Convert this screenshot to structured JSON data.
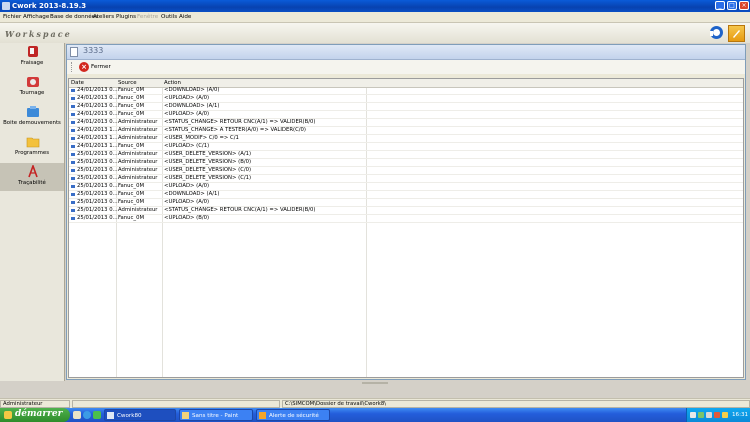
{
  "window": {
    "title": "Cwork 2013-8.19.3"
  },
  "menu": [
    "Fichier",
    "Affichage",
    "Base de données",
    "Ateliers",
    "Plugins",
    "Fenêtre",
    "Outils",
    "Aide"
  ],
  "workspace": {
    "label": "Workspace"
  },
  "sidebar": {
    "items": [
      {
        "label": "Fraisage",
        "icon": "milling-icon"
      },
      {
        "label": "Tournage",
        "icon": "turning-icon"
      },
      {
        "label": "Boite demouvements",
        "icon": "toolbox-icon"
      },
      {
        "label": "Programmes",
        "icon": "folder-icon"
      },
      {
        "label": "Traçabilité",
        "icon": "traceability-icon",
        "selected": true
      }
    ]
  },
  "panel": {
    "title": "3333",
    "close_label": "Fermer"
  },
  "table": {
    "columns": [
      "Date",
      "Source",
      "Action"
    ],
    "rows": [
      [
        "24/01/2013 0...",
        "Fanuc_0M",
        "<DOWNLOAD> (A/0)"
      ],
      [
        "24/01/2013 0...",
        "Fanuc_0M",
        "<UPLOAD> (A/0)"
      ],
      [
        "24/01/2013 0...",
        "Fanuc_0M",
        "<DOWNLOAD> (A/1)"
      ],
      [
        "24/01/2013 0...",
        "Fanuc_0M",
        "<UPLOAD> (A/0)"
      ],
      [
        "24/01/2013 0...",
        "Administrateur",
        "<STATUS_CHANGE> RETOUR CNC(A/1) => VALIDER(B/0)"
      ],
      [
        "24/01/2013 1...",
        "Administrateur",
        "<STATUS_CHANGE> A TESTER(A/0) => VALIDER(C/0)"
      ],
      [
        "24/01/2013 1...",
        "Administrateur",
        "<USER_MODIF> C/0 => C/1"
      ],
      [
        "24/01/2013 1...",
        "Fanuc_0M",
        "<UPLOAD> (C/1)"
      ],
      [
        "25/01/2013 0...",
        "Administrateur",
        "<USER_DELETE_VERSION> (A/1)"
      ],
      [
        "25/01/2013 0...",
        "Administrateur",
        "<USER_DELETE_VERSION> (B/0)"
      ],
      [
        "25/01/2013 0...",
        "Administrateur",
        "<USER_DELETE_VERSION> (C/0)"
      ],
      [
        "25/01/2013 0...",
        "Administrateur",
        "<USER_DELETE_VERSION> (C/1)"
      ],
      [
        "25/01/2013 0...",
        "Fanuc_0M",
        "<UPLOAD> (A/0)"
      ],
      [
        "25/01/2013 0...",
        "Fanuc_0M",
        "<DOWNLOAD> (A/1)"
      ],
      [
        "25/01/2013 0...",
        "Fanuc_0M",
        "<UPLOAD> (A/0)"
      ],
      [
        "25/01/2013 0...",
        "Administrateur",
        "<STATUS_CHANGE> RETOUR CNC(A/1) => VALIDER(B/0)"
      ],
      [
        "25/01/2013 0...",
        "Fanuc_0M",
        "<UPLOAD> (B/0)"
      ]
    ]
  },
  "status": {
    "user": "Administrateur",
    "path": "C:\\SIMCOM\\Dossier de travail\\Cwork8\\"
  },
  "taskbar": {
    "start_label": "démarrer",
    "tasks": [
      {
        "label": "Cwork80",
        "active": true
      },
      {
        "label": "Sans titre - Paint",
        "active": false
      },
      {
        "label": "Alerte de sécurité",
        "active": false
      }
    ],
    "clock": "16:31"
  },
  "colors": {
    "titlebar": "#0842b0",
    "taskbar": "#245edb",
    "start": "#2e8c2b",
    "accent_red": "#d2281e"
  }
}
